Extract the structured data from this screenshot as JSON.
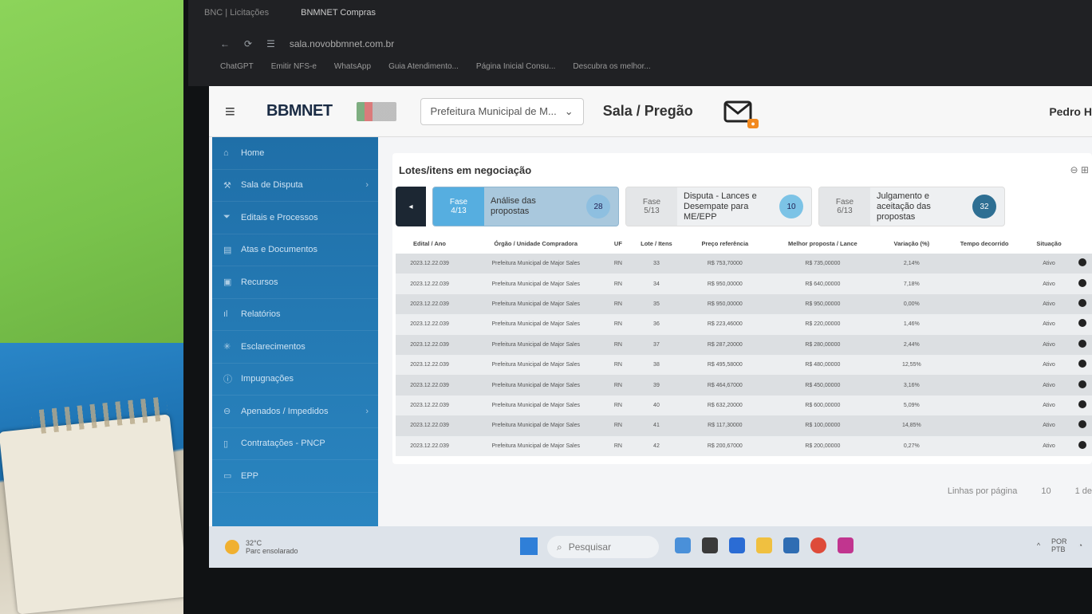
{
  "browser": {
    "tabs": [
      "BNC | Licitações",
      "BNMNET Compras"
    ],
    "url": "sala.novobbmnet.com.br",
    "bookmarks": [
      "ChatGPT",
      "Emitir NFS-e",
      "WhatsApp",
      "Guia Atendimento...",
      "Página Inicial Consu...",
      "Descubra os melhor..."
    ]
  },
  "header": {
    "logo": "BBMNET",
    "entity_select": "Prefeitura Municipal de M...",
    "page_title": "Sala / Pregão",
    "user_name": "Pedro H"
  },
  "sidebar": {
    "items": [
      {
        "label": "Home",
        "icon": "home-icon"
      },
      {
        "label": "Sala de Disputa",
        "icon": "gavel-icon",
        "chevron": "›"
      },
      {
        "label": "Editais e Processos",
        "icon": "filter-icon"
      },
      {
        "label": "Atas e Documentos",
        "icon": "document-icon"
      },
      {
        "label": "Recursos",
        "icon": "clipboard-icon"
      },
      {
        "label": "Relatórios",
        "icon": "chart-icon"
      },
      {
        "label": "Esclarecimentos",
        "icon": "asterisk-icon"
      },
      {
        "label": "Impugnações",
        "icon": "alert-icon"
      },
      {
        "label": "Apenados / Impedidos",
        "icon": "blocked-icon",
        "chevron": "›"
      },
      {
        "label": "Contratações - PNCP",
        "icon": "file-icon"
      },
      {
        "label": "EPP",
        "icon": "briefcase-icon"
      }
    ]
  },
  "panel": {
    "title": "Lotes/itens em negociação",
    "phases": [
      {
        "num": "Fase",
        "of": "4/13",
        "desc": "Análise das propostas",
        "count": "28"
      },
      {
        "num": "Fase",
        "of": "5/13",
        "desc": "Disputa - Lances e Desempate para ME/EPP",
        "count": "10"
      },
      {
        "num": "Fase",
        "of": "6/13",
        "desc": "Julgamento e aceitação das propostas",
        "count": "32"
      }
    ],
    "table": {
      "headers": [
        "Edital / Ano",
        "Órgão / Unidade Compradora",
        "UF",
        "Lote / Itens",
        "Preço referência",
        "Melhor proposta / Lance",
        "Variação (%)",
        "Tempo decorrido",
        "Situação",
        ""
      ],
      "rows": [
        [
          "2023.12.22.039",
          "Prefeitura Municipal de Major Sales",
          "RN",
          "33",
          "R$ 753,70000",
          "R$ 735,00000",
          "2,14%",
          "",
          "Ativo"
        ],
        [
          "2023.12.22.039",
          "Prefeitura Municipal de Major Sales",
          "RN",
          "34",
          "R$ 950,00000",
          "R$ 640,00000",
          "7,18%",
          "",
          "Ativo"
        ],
        [
          "2023.12.22.039",
          "Prefeitura Municipal de Major Sales",
          "RN",
          "35",
          "R$ 950,00000",
          "R$ 950,00000",
          "0,00%",
          "",
          "Ativo"
        ],
        [
          "2023.12.22.039",
          "Prefeitura Municipal de Major Sales",
          "RN",
          "36",
          "R$ 223,46000",
          "R$ 220,00000",
          "1,46%",
          "",
          "Ativo"
        ],
        [
          "2023.12.22.039",
          "Prefeitura Municipal de Major Sales",
          "RN",
          "37",
          "R$ 287,20000",
          "R$ 280,00000",
          "2,44%",
          "",
          "Ativo"
        ],
        [
          "2023.12.22.039",
          "Prefeitura Municipal de Major Sales",
          "RN",
          "38",
          "R$ 495,58000",
          "R$ 480,00000",
          "12,55%",
          "",
          "Ativo"
        ],
        [
          "2023.12.22.039",
          "Prefeitura Municipal de Major Sales",
          "RN",
          "39",
          "R$ 464,67000",
          "R$ 450,00000",
          "3,16%",
          "",
          "Ativo"
        ],
        [
          "2023.12.22.039",
          "Prefeitura Municipal de Major Sales",
          "RN",
          "40",
          "R$ 632,20000",
          "R$ 600,00000",
          "5,09%",
          "",
          "Ativo"
        ],
        [
          "2023.12.22.039",
          "Prefeitura Municipal de Major Sales",
          "RN",
          "41",
          "R$ 117,30000",
          "R$ 100,00000",
          "14,85%",
          "",
          "Ativo"
        ],
        [
          "2023.12.22.039",
          "Prefeitura Municipal de Major Sales",
          "RN",
          "42",
          "R$ 200,67000",
          "R$ 200,00000",
          "0,27%",
          "",
          "Ativo"
        ]
      ]
    },
    "pagination": {
      "label": "Linhas por página",
      "value": "10",
      "range": "1 de"
    }
  },
  "taskbar": {
    "temp": "32°C",
    "weather": "Parc ensolarado",
    "search": "Pesquisar",
    "lang": "POR",
    "kb": "PTB"
  }
}
